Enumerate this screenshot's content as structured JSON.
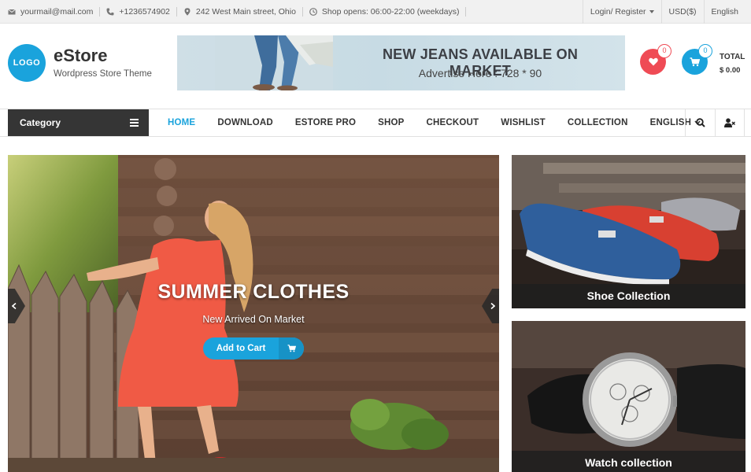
{
  "topbar": {
    "email": "yourmail@mail.com",
    "phone": "+1236574902",
    "address": "242 West Main street, Ohio",
    "hours": "Shop opens: 06:00-22:00 (weekdays)",
    "login": "Login/ Register",
    "currency": "USD($)",
    "language": "English"
  },
  "header": {
    "logo_text": "LOGO",
    "site_title": "eStore",
    "tagline": "Wordpress Store Theme",
    "banner_headline": "NEW JEANS AVAILABLE ON MARKET",
    "banner_subline": "Advertise Here : 728 * 90",
    "wishlist_count": "0",
    "cart_count": "0",
    "total_label": "TOTAL",
    "total_value": "$ 0.00"
  },
  "nav": {
    "category_label": "Category",
    "items": [
      {
        "label": "HOME"
      },
      {
        "label": "DOWNLOAD"
      },
      {
        "label": "ESTORE PRO"
      },
      {
        "label": "SHOP"
      },
      {
        "label": "CHECKOUT"
      },
      {
        "label": "WISHLIST"
      },
      {
        "label": "COLLECTION"
      },
      {
        "label": "ENGLISH"
      }
    ]
  },
  "slider": {
    "title": "SUMMER CLOTHES",
    "subtitle": "New Arrived On Market",
    "button_label": "Add to Cart"
  },
  "promos": {
    "shoe_caption": "Shoe Collection",
    "watch_caption": "Watch collection"
  },
  "colors": {
    "accent": "#1aa3dc",
    "wishlist": "#ef4b55",
    "dark": "#353535"
  }
}
